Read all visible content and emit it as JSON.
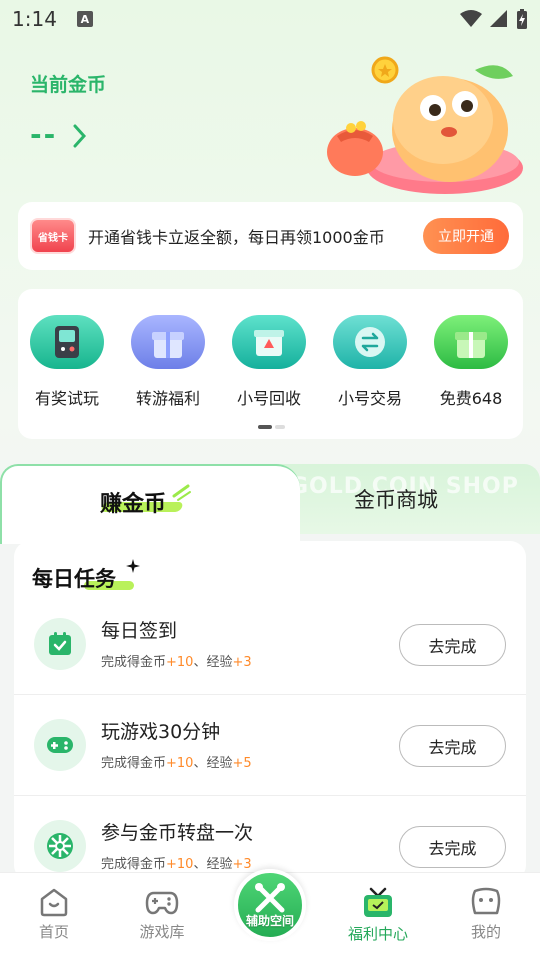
{
  "status_bar": {
    "time": "1:14",
    "notification_letter": "A"
  },
  "header": {
    "coins_title": "当前金币",
    "coins_value": "--"
  },
  "promo": {
    "badge": "省钱卡",
    "text": "开通省钱卡立返全额，每日再领1000金币",
    "button_label": "立即开通"
  },
  "quick_actions": [
    {
      "label": "有奖试玩",
      "icon": "handheld-console-icon",
      "color": "#23c49a"
    },
    {
      "label": "转游福利",
      "icon": "gift-box-icon",
      "color": "#7a8cf2"
    },
    {
      "label": "小号回收",
      "icon": "recycle-box-icon",
      "color": "#22bfa8"
    },
    {
      "label": "小号交易",
      "icon": "exchange-coin-icon",
      "color": "#2ec2b4"
    },
    {
      "label": "免费648",
      "icon": "green-gift-icon",
      "color": "#3fcf5a"
    }
  ],
  "tabs": {
    "earn": "赚金币",
    "shop": "金币商城",
    "shop_watermark": "GOLD COIN SHOP"
  },
  "tasks": {
    "title": "每日任务",
    "items": [
      {
        "name": "每日签到",
        "reward_prefix": "完成得金币",
        "coins": "+10",
        "sep": "、经验",
        "exp": "+3",
        "button": "去完成",
        "icon": "calendar-check-icon"
      },
      {
        "name": "玩游戏30分钟",
        "reward_prefix": "完成得金币",
        "coins": "+10",
        "sep": "、经验",
        "exp": "+5",
        "button": "去完成",
        "icon": "gamepad-icon"
      },
      {
        "name": "参与金币转盘一次",
        "reward_prefix": "完成得金币",
        "coins": "+10",
        "sep": "、经验",
        "exp": "+3",
        "button": "去完成",
        "icon": "spin-wheel-icon"
      }
    ]
  },
  "bottom_nav": {
    "items": [
      {
        "label": "首页",
        "icon": "home-icon"
      },
      {
        "label": "游戏库",
        "icon": "gamepad-outline-icon"
      },
      {
        "label": "辅助空间",
        "icon": "tools-icon"
      },
      {
        "label": "福利中心",
        "icon": "gift-tv-icon",
        "active": true
      },
      {
        "label": "我的",
        "icon": "profile-face-icon"
      }
    ]
  },
  "colors": {
    "accent_green": "#2ab56a",
    "orange": "#ff7a3d",
    "reward_orange": "#ff8a2a"
  }
}
